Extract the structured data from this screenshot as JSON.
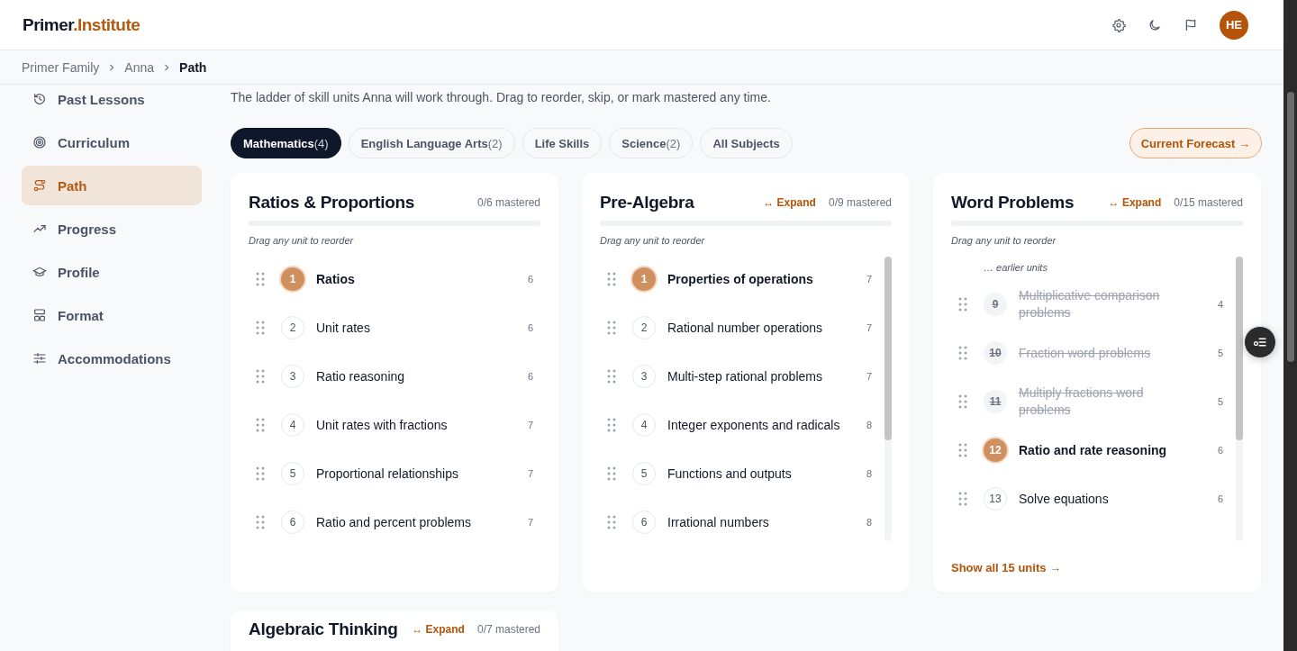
{
  "brand": {
    "primary": "Primer",
    "accent": ".Institute"
  },
  "header": {
    "avatar": "HE"
  },
  "breadcrumb": [
    {
      "label": "Primer Family",
      "current": false
    },
    {
      "label": "Anna",
      "current": false
    },
    {
      "label": "Path",
      "current": true
    }
  ],
  "sidebar": {
    "items": [
      {
        "label": "Past Lessons",
        "selected": false
      },
      {
        "label": "Curriculum",
        "selected": false
      },
      {
        "label": "Path",
        "selected": true
      },
      {
        "label": "Progress",
        "selected": false
      },
      {
        "label": "Profile",
        "selected": false
      },
      {
        "label": "Format",
        "selected": false
      },
      {
        "label": "Accommodations",
        "selected": false
      }
    ]
  },
  "description": "The ladder of skill units Anna will work through. Drag to reorder, skip, or mark mastered any time.",
  "subject_tabs": [
    {
      "label": "Mathematics",
      "count": "(4)",
      "selected": true
    },
    {
      "label": "English Language Arts",
      "count": "(2)",
      "selected": false
    },
    {
      "label": "Life Skills",
      "selected": false
    },
    {
      "label": "Science",
      "count": "(2)",
      "selected": false
    },
    {
      "label": "All Subjects",
      "selected": false
    }
  ],
  "forecast_button": "Current Forecast →",
  "cards": [
    {
      "title": "Ratios & Proportions",
      "mastered": "0/6 mastered",
      "level": 0,
      "hint": "Drag any unit to reorder",
      "units": [
        {
          "number": "1",
          "title": "Ratios",
          "count": "6",
          "kind": "current"
        },
        {
          "number": "2",
          "title": "Unit rates",
          "count": "6",
          "kind": "upcoming"
        },
        {
          "number": "3",
          "title": "Ratio reasoning",
          "count": "6",
          "kind": "upcoming"
        },
        {
          "number": "4",
          "title": "Unit rates with fractions",
          "count": "7",
          "kind": "upcoming"
        },
        {
          "number": "5",
          "title": "Proportional relationships",
          "count": "7",
          "kind": "upcoming"
        },
        {
          "number": "6",
          "title": "Ratio and percent problems",
          "count": "7",
          "kind": "upcoming"
        }
      ]
    },
    {
      "title": "Pre-Algebra",
      "expand": "↔ Expand",
      "mastered": "0/9 mastered",
      "level": 0,
      "hint": "Drag any unit to reorder",
      "scrollable": true,
      "units": [
        {
          "number": "1",
          "title": "Properties of operations",
          "count": "7",
          "kind": "current"
        },
        {
          "number": "2",
          "title": "Rational number operations",
          "count": "7",
          "kind": "upcoming"
        },
        {
          "number": "3",
          "title": "Multi-step rational problems",
          "count": "7",
          "kind": "upcoming"
        },
        {
          "number": "4",
          "title": "Integer exponents and radicals",
          "count": "8",
          "kind": "upcoming"
        },
        {
          "number": "5",
          "title": "Functions and outputs",
          "count": "8",
          "kind": "upcoming"
        },
        {
          "number": "6",
          "title": "Irrational numbers",
          "count": "8",
          "kind": "upcoming"
        }
      ]
    },
    {
      "title": "Word Problems",
      "expand": "↔ Expand",
      "mastered": "0/15 mastered",
      "level": 0,
      "hint": "Drag any unit to reorder",
      "scrollable": true,
      "earlier_note": "… earlier units",
      "units": [
        {
          "number": "9",
          "title": "Multiplicative comparison problems",
          "count": "4",
          "kind": "skipped"
        },
        {
          "number": "10",
          "title": "Fraction word problems",
          "count": "5",
          "kind": "skipped"
        },
        {
          "number": "11",
          "title": "Multiply fractions word problems",
          "count": "5",
          "kind": "skipped"
        },
        {
          "number": "12",
          "title": "Ratio and rate reasoning",
          "count": "6",
          "kind": "current"
        },
        {
          "number": "13",
          "title": "Solve equations",
          "count": "6",
          "kind": "upcoming"
        }
      ],
      "show_all": "Show all 15 units →"
    },
    {
      "title": "Algebraic Thinking",
      "expand": "↔ Expand",
      "mastered": "0/7 mastered"
    }
  ]
}
